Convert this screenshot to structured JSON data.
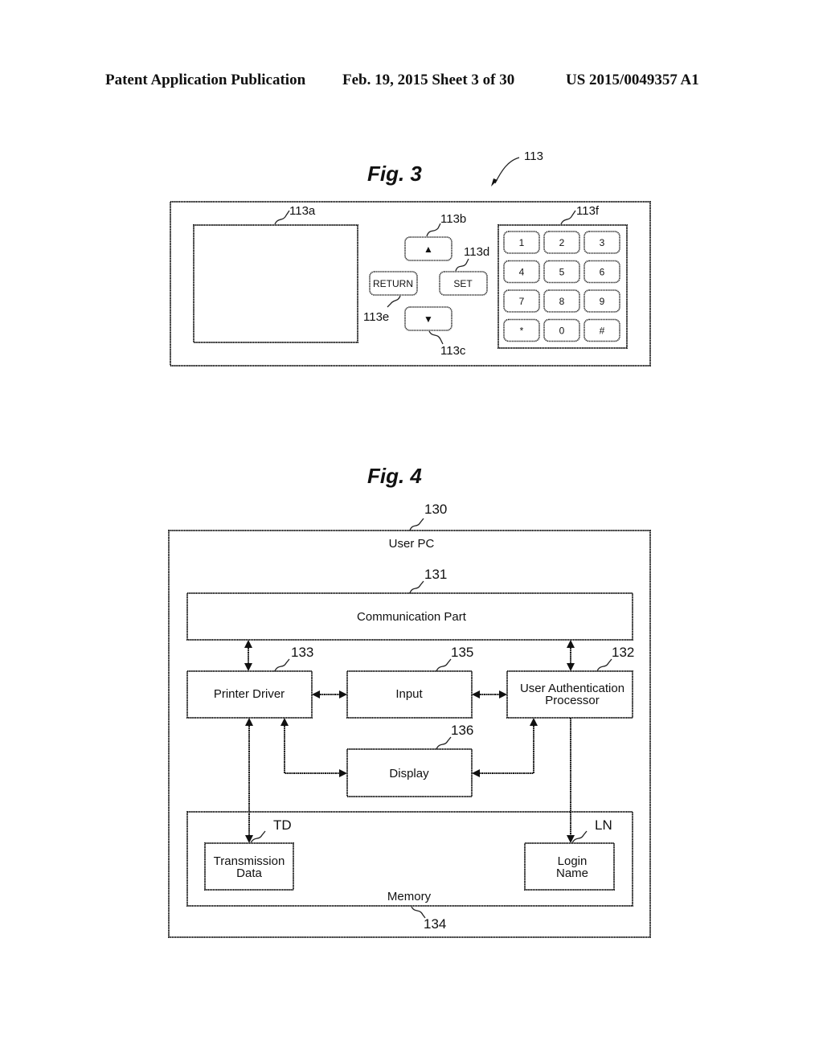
{
  "header": {
    "publication": "Patent Application Publication",
    "date_sheet": "Feb. 19, 2015   Sheet 3 of 30",
    "number": "US 2015/0049357 A1"
  },
  "fig3": {
    "title": "Fig. 3",
    "ref_panel": "113",
    "ref_screen": "113a",
    "ref_up": "113b",
    "ref_down": "113c",
    "ref_set": "113d",
    "ref_return": "113e",
    "ref_keypad": "113f",
    "up_glyph": "▲",
    "down_glyph": "▼",
    "return_label": "RETURN",
    "set_label": "SET",
    "keypad_keys": [
      "1",
      "2",
      "3",
      "4",
      "5",
      "6",
      "7",
      "8",
      "9",
      "*",
      "0",
      "#"
    ]
  },
  "fig4": {
    "title": "Fig. 4",
    "user_pc": {
      "ref": "130",
      "label": "User PC"
    },
    "communication_part": {
      "ref": "131",
      "label": "Communication Part"
    },
    "printer_driver": {
      "ref": "133",
      "label": "Printer Driver"
    },
    "input": {
      "ref": "135",
      "label": "Input"
    },
    "user_auth": {
      "ref": "132",
      "line1": "User Authentication",
      "line2": "Processor"
    },
    "display": {
      "ref": "136",
      "label": "Display"
    },
    "memory": {
      "ref": "134",
      "label": "Memory"
    },
    "transmission_data": {
      "ref": "TD",
      "line1": "Transmission",
      "line2": "Data"
    },
    "login_name": {
      "ref": "LN",
      "line1": "Login",
      "line2": "Name"
    }
  }
}
